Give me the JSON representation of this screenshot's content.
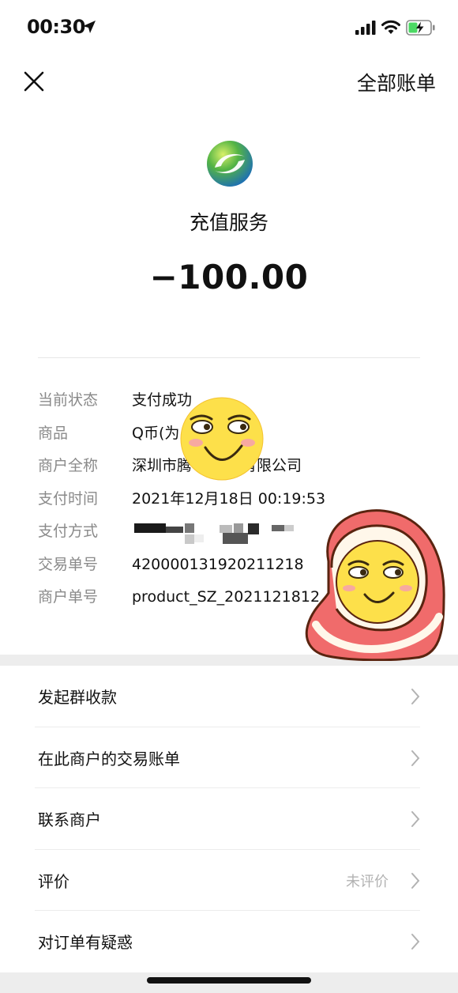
{
  "status_bar": {
    "time": "00:30"
  },
  "header": {
    "right_link": "全部账单"
  },
  "summary": {
    "merchant": "充值服务",
    "amount": "−100.00"
  },
  "details": [
    {
      "label": "当前状态",
      "value": "支付成功"
    },
    {
      "label": "商品",
      "value": "Q币(为                  8购买)"
    },
    {
      "label": "商户全称",
      "value": "深圳市腾           机系统有限公司"
    },
    {
      "label": "支付时间",
      "value": "2021年12月18日 00:19:53"
    },
    {
      "label": "支付方式",
      "value": ""
    },
    {
      "label": "交易单号",
      "value": "420000131920211218"
    },
    {
      "label": "商户单号",
      "value": "product_SZ_2021121812"
    }
  ],
  "menu": [
    {
      "label": "发起群收款",
      "extra": ""
    },
    {
      "label": "在此商户的交易账单",
      "extra": ""
    },
    {
      "label": "联系商户",
      "extra": ""
    },
    {
      "label": "评价",
      "extra": "未评价"
    },
    {
      "label": "对订单有疑惑",
      "extra": ""
    }
  ],
  "icons": {
    "close": "close-icon",
    "chevron": "chevron-right-icon",
    "location": "location-arrow-icon",
    "signal": "signal-icon",
    "wifi": "wifi-icon",
    "battery": "battery-charging-icon"
  },
  "colors": {
    "label_gray": "#8a8a8a",
    "background": "#ededed",
    "battery_green": "#4cd964"
  }
}
